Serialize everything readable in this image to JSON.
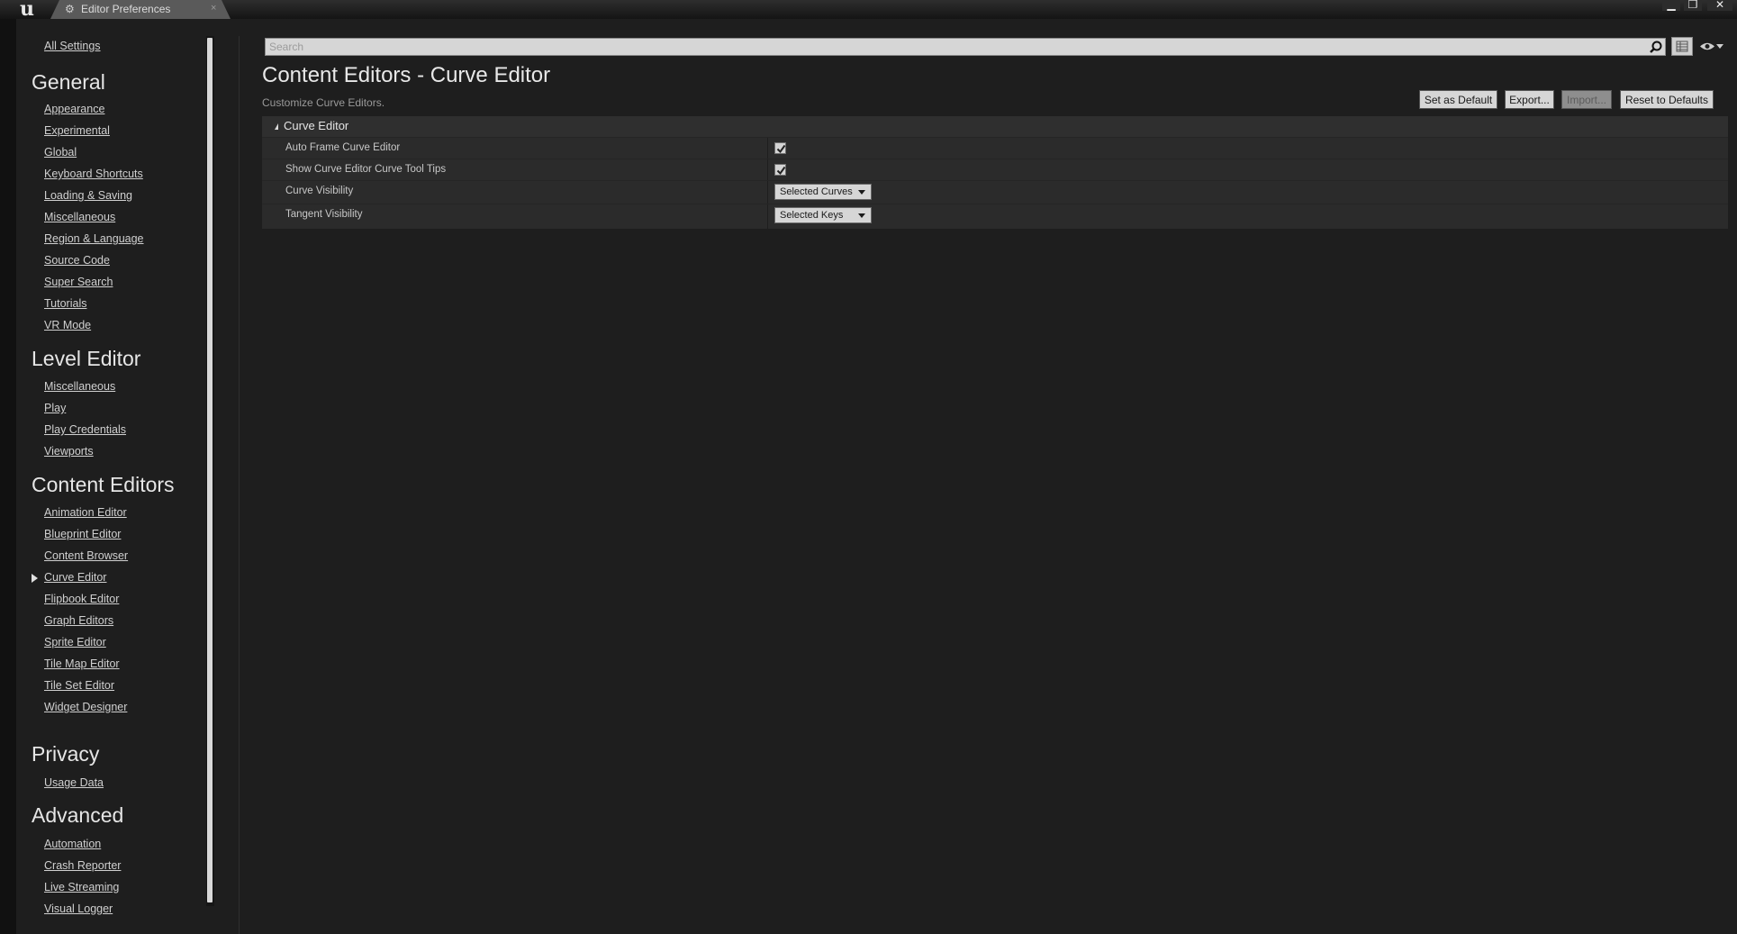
{
  "window": {
    "tab_title": "Editor Preferences",
    "close_glyph": "×",
    "controls": [
      "minimize-icon",
      "restore-icon",
      "close-icon"
    ]
  },
  "sidebar": {
    "all_settings": "All Settings",
    "sections": [
      {
        "title": "General",
        "items": [
          "Appearance",
          "Experimental",
          "Global",
          "Keyboard Shortcuts",
          "Loading & Saving",
          "Miscellaneous",
          "Region & Language",
          "Source Code",
          "Super Search",
          "Tutorials",
          "VR Mode"
        ]
      },
      {
        "title": "Level Editor",
        "items": [
          "Miscellaneous",
          "Play",
          "Play Credentials",
          "Viewports"
        ]
      },
      {
        "title": "Content Editors",
        "items": [
          "Animation Editor",
          "Blueprint Editor",
          "Content Browser",
          "Curve Editor",
          "Flipbook Editor",
          "Graph Editors",
          "Sprite Editor",
          "Tile Map Editor",
          "Tile Set Editor",
          "Widget Designer"
        ]
      },
      {
        "title": "Privacy",
        "items": [
          "Usage Data"
        ]
      },
      {
        "title": "Advanced",
        "items": [
          "Automation",
          "Crash Reporter",
          "Live Streaming",
          "Visual Logger"
        ]
      }
    ],
    "selected_item": "Curve Editor"
  },
  "search": {
    "placeholder": "Search",
    "value": ""
  },
  "main": {
    "title": "Content Editors - Curve Editor",
    "subtitle": "Customize Curve Editors.",
    "buttons": {
      "set_default": "Set as Default",
      "export": "Export...",
      "import": "Import...",
      "reset": "Reset to Defaults"
    },
    "panel": {
      "title": "Curve Editor",
      "rows": [
        {
          "label": "Auto Frame Curve Editor",
          "type": "checkbox",
          "checked": true
        },
        {
          "label": "Show Curve Editor Curve Tool Tips",
          "type": "checkbox",
          "checked": true
        },
        {
          "label": "Curve Visibility",
          "type": "combo",
          "value": "Selected Curves"
        },
        {
          "label": "Tangent Visibility",
          "type": "combo",
          "value": "Selected Keys"
        }
      ]
    }
  },
  "colors": {
    "background": "#1e1e1e",
    "panel": "#323232",
    "text": "#c8c8c8",
    "button": "#d6d6d6"
  }
}
